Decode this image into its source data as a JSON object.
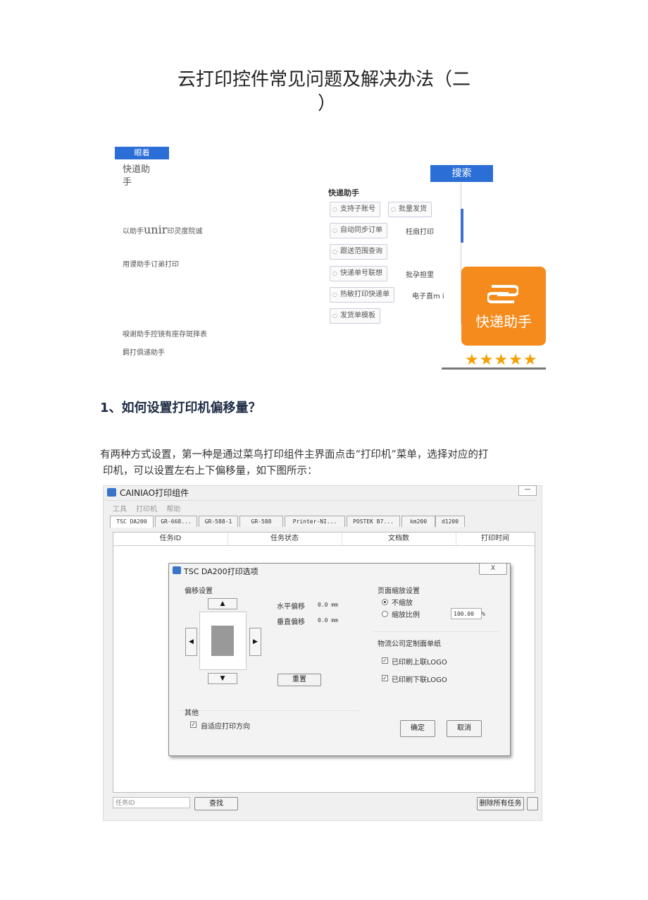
{
  "doc": {
    "title_line1": "云打印控件常见问题及解决办法（二",
    "title_line2": "）",
    "section_heading": "1、如何设置打印机偏移量？",
    "paragraph_line1": "有两种方式设置，第一种是通过菜鸟打印组件主界面点击“打印机”菜单，选择对应的打",
    "paragraph_line2": "印机，可以设置左右上下偏移量，如下图所示："
  },
  "illustration": {
    "blue_tag": "眼着",
    "left_items": [
      "快道助",
      "手",
      "以助手",
      "unir",
      "印灵度院诚",
      "用谡助手订弟打印",
      "唳谢助手控镜有座存斑择表",
      "羁打俱递助手"
    ],
    "search_label": "搜索",
    "panel_title": "快递助手",
    "pills": [
      "支持子账号",
      "批量发货",
      "自动同步订单",
      "跟送范围查询",
      "快递单号联想",
      "热敏打印快递单",
      "发货单模板"
    ],
    "side_labels": [
      "枉扇打印",
      "批孕担里",
      "电子直m i"
    ],
    "badge_text": "快递助手",
    "stars": "★★★★★",
    "accent_color": "#f58b1c",
    "brand_blue": "#2b6fd6"
  },
  "screenshot": {
    "window_title": "CAINIAO打印组件",
    "minimize": "—",
    "menu": [
      "工具",
      "打印机",
      "帮助"
    ],
    "tabs": [
      "TSC DA200",
      "GR-668...",
      "GR-588-1",
      "GR-588",
      "Printer-NI...",
      "POSTEK B7...",
      "km200",
      "d1200"
    ],
    "columns": [
      "任务ID",
      "任务状态",
      "文档数",
      "打印时间"
    ],
    "dialog": {
      "title": "TSC DA200打印选项",
      "close": "X",
      "offset_group": "偏移设置",
      "h_offset_label": "水平偏移",
      "h_offset_value": "0.0 mm",
      "v_offset_label": "垂直偏移",
      "v_offset_value": "0.0 mm",
      "reset": "重置",
      "scale_group": "页面缩放设置",
      "no_scale": "不缩放",
      "scale_ratio": "缩放比例",
      "scale_value": "100.00",
      "percent": "%",
      "carrier_group": "物流公司定制面单纸",
      "upper_logo": "已印刷上联LOGO",
      "lower_logo": "已印刷下联LOGO",
      "other_group": "其他",
      "auto_direction": "自适应打印方向",
      "ok": "确定",
      "cancel": "取消"
    },
    "search_placeholder": "任务ID",
    "find": "查找",
    "delete_all": "删除所有任务"
  }
}
